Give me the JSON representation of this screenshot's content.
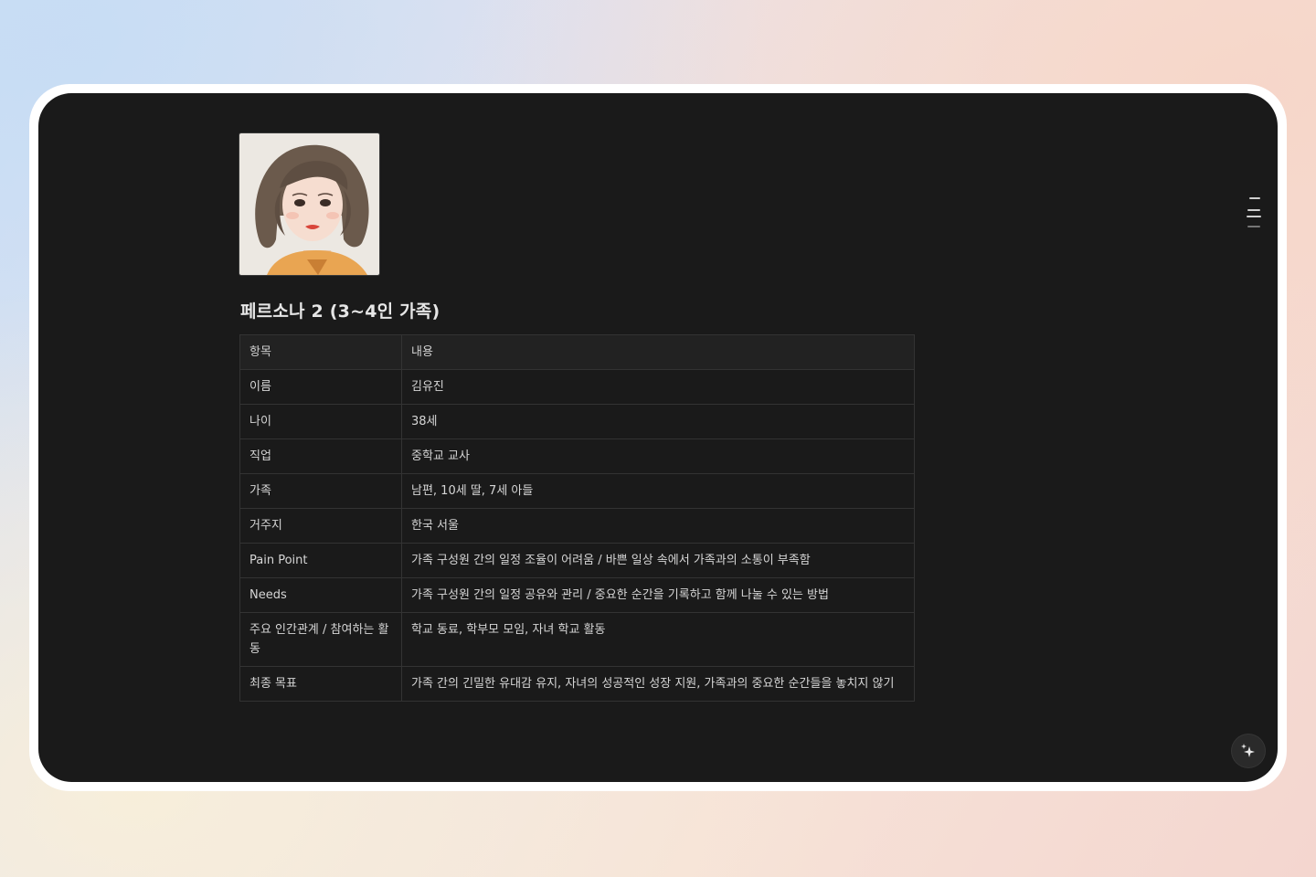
{
  "page": {
    "title": "페르소나 2 (3~4인 가족)"
  },
  "avatar": {
    "icon": "persona-portrait-image"
  },
  "table": {
    "header": {
      "key": "항목",
      "value": "내용"
    },
    "rows": [
      {
        "key": "이름",
        "value": "김유진"
      },
      {
        "key": "나이",
        "value": "38세"
      },
      {
        "key": "직업",
        "value": "중학교 교사"
      },
      {
        "key": "가족",
        "value": "남편, 10세 딸, 7세 아들"
      },
      {
        "key": "거주지",
        "value": "한국 서울"
      },
      {
        "key": "Pain Point",
        "value": "가족 구성원 간의 일정 조율이 어려움 / 바쁜 일상 속에서 가족과의 소통이 부족함"
      },
      {
        "key": "Needs",
        "value": "가족 구성원 간의 일정 공유와 관리 / 중요한 순간을 기록하고 함께 나눌 수 있는 방법"
      },
      {
        "key": "주요 인간관계 / 참여하는 활동",
        "value": "학교 동료, 학부모 모임, 자녀 학교 활동"
      },
      {
        "key": "최종 목표",
        "value": "가족 간의 긴밀한 유대감 유지, 자녀의 성공적인 성장 지원, 가족과의 중요한 순간들을 놓치지 않기"
      }
    ]
  },
  "controls": {
    "toc_icon": "table-of-contents-icon",
    "ai_icon": "sparkle-icon"
  },
  "colors": {
    "window_bg": "#1a1a1a",
    "text": "#d6d6d6",
    "border": "#333333"
  }
}
